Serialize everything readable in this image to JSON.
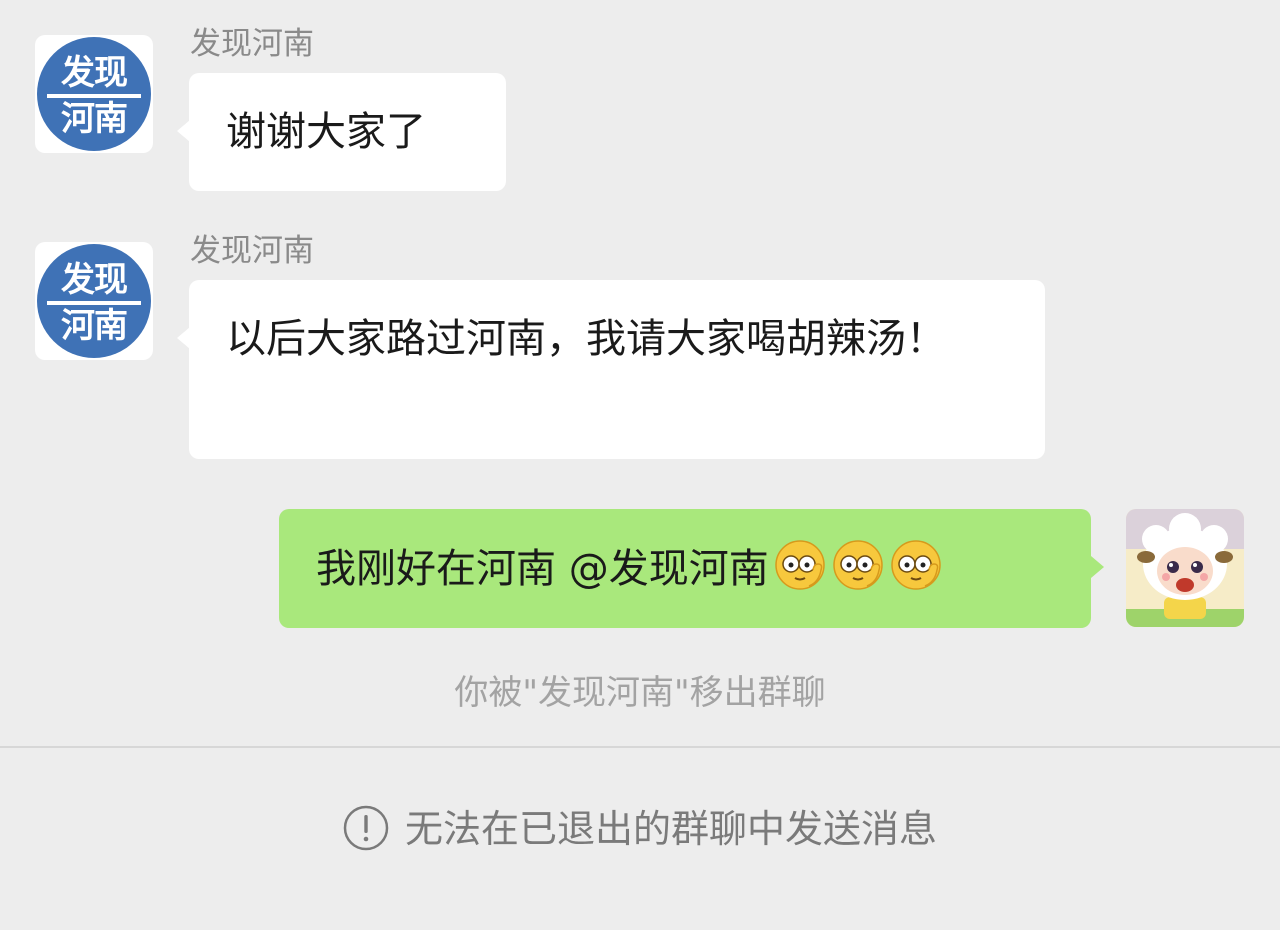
{
  "messages": [
    {
      "sender": "发现河南",
      "text": "谢谢大家了",
      "avatar_logo": [
        "发现",
        "河南"
      ]
    },
    {
      "sender": "发现河南",
      "text": "以后大家路过河南，我请大家喝胡辣汤！",
      "avatar_logo": [
        "发现",
        "河南"
      ]
    },
    {
      "sender": "self",
      "text": "我刚好在河南 @发现河南",
      "emojis": [
        "monocle-face-emoji",
        "monocle-face-emoji",
        "monocle-face-emoji"
      ]
    }
  ],
  "system_notice": "你被\"发现河南\"移出群聊",
  "bottom_notice": "无法在已退出的群聊中发送消息",
  "colors": {
    "background": "#ededed",
    "self_bubble": "#a9e87c",
    "other_bubble": "#ffffff",
    "avatar_blue": "#3f72b6",
    "sender_name": "#8a8a8a",
    "system_text": "#a3a3a3"
  }
}
